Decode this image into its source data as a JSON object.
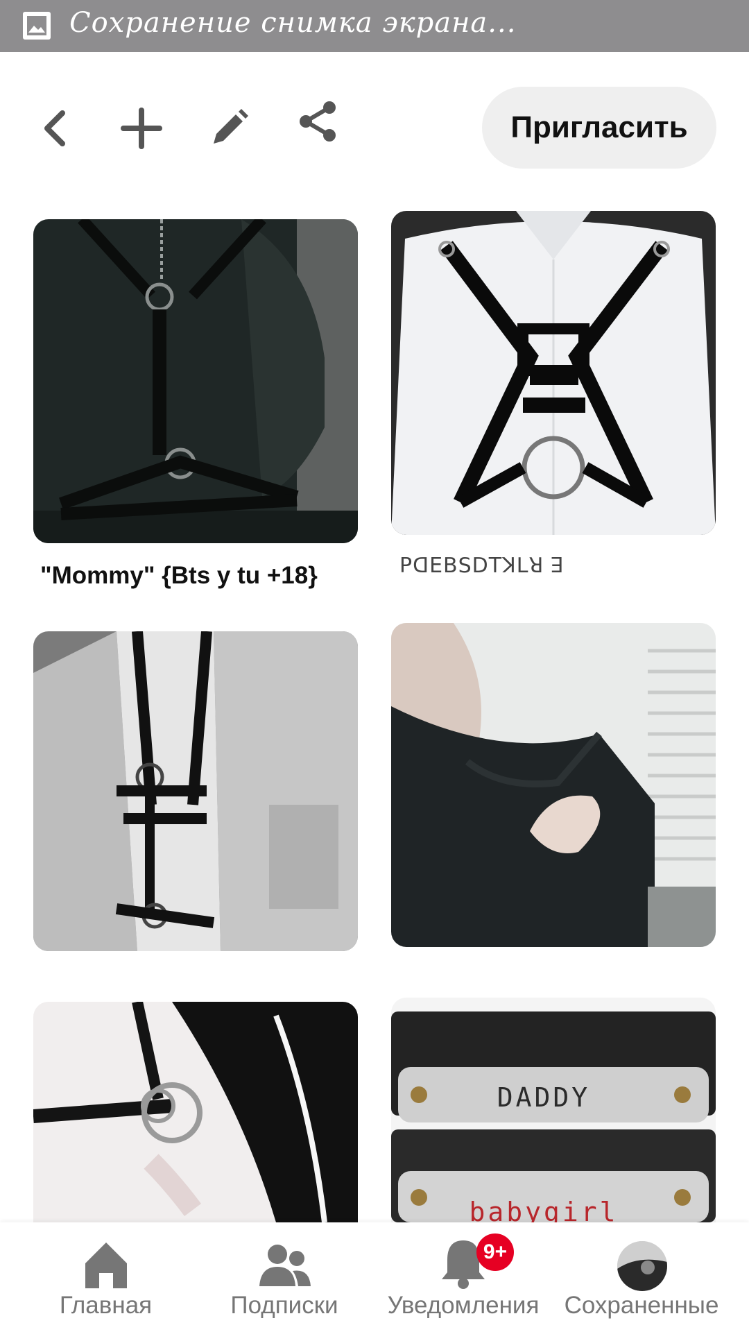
{
  "statusbar": {
    "text": "Сохранение снимка экрана...",
    "icon": "image-icon"
  },
  "toolbar": {
    "back_icon": "chevron-left-icon",
    "add_icon": "plus-icon",
    "edit_icon": "pencil-icon",
    "share_icon": "share-icon",
    "invite_label": "Пригласить"
  },
  "pins": [
    {
      "caption": "\"Mommy\" {Bts y tu +18}",
      "image": "black leather harness over dark sweater"
    },
    {
      "caption": "ꓑꓷꓰꓐꓢꓓꓔꓘꓡꓤ ꓱ",
      "image": "patent leather harness over white shirt"
    },
    {
      "caption": "",
      "image": "harness under open denim shirt"
    },
    {
      "caption": "",
      "image": "hand on dark sweater near window blinds"
    },
    {
      "caption": "",
      "image": "black choker with metal rings"
    },
    {
      "caption": "",
      "image": "leather bracelets"
    }
  ],
  "bracelet_text": {
    "top": "DADDY",
    "bottom": "babygirl"
  },
  "bottomnav": {
    "items": [
      {
        "label": "Главная",
        "icon": "home-icon"
      },
      {
        "label": "Подписки",
        "icon": "people-icon"
      },
      {
        "label": "Уведомления",
        "icon": "bell-icon"
      },
      {
        "label": "Сохраненные",
        "icon": "avatar"
      }
    ],
    "badge": "9+"
  },
  "colors": {
    "statusbar": "#8e8d8f",
    "badge": "#e60023",
    "invite_bg": "#efefef",
    "nav_icon": "#767676"
  }
}
